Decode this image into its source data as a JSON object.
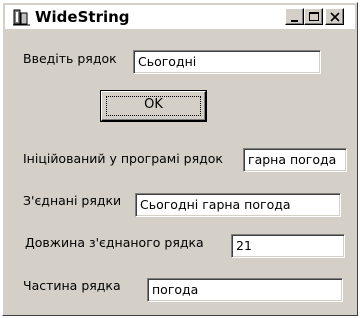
{
  "window": {
    "title": "WideString",
    "icons": {
      "app": "app-icon",
      "minimize": "minimize-icon",
      "maximize": "maximize-icon",
      "close": "close-icon"
    }
  },
  "form": {
    "input_label": "Введіть рядок",
    "input_value": "Сьогодні",
    "ok_label": "OK",
    "init_label": "Ініційований у програмі рядок",
    "init_value": "гарна погода",
    "joined_label": "З'єднані рядки",
    "joined_value": "Сьогодні гарна погода",
    "length_label": "Довжина з'єднаного рядка",
    "length_value": "21",
    "part_label": "Частина рядка",
    "part_value": "погода"
  }
}
